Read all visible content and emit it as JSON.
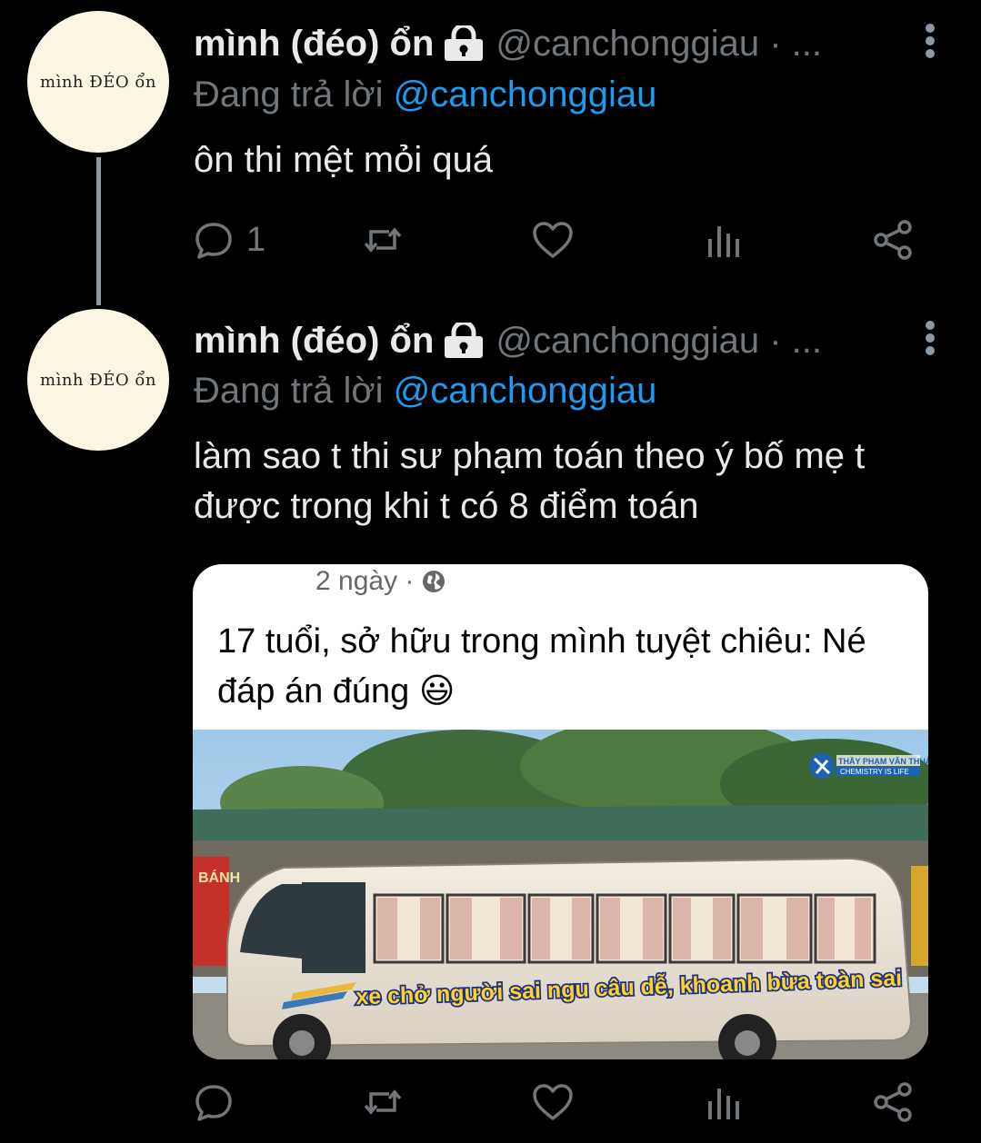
{
  "tweets": [
    {
      "avatar_text": "mình ĐÉO ổn",
      "display_name": "mình (đéo) ổn",
      "handle": "@canchonggiau · ...",
      "reply_prefix": "Đang trả lời",
      "reply_to": "@canchonggiau",
      "text": "ôn thi mệt mỏi quá",
      "reply_count": "1"
    },
    {
      "avatar_text": "mình ĐÉO ổn",
      "display_name": "mình (đéo) ổn",
      "handle": "@canchonggiau · ...",
      "reply_prefix": "Đang trả lời",
      "reply_to": "@canchonggiau",
      "text": "làm sao t thi sư phạm toán theo ý bố mẹ t được trong khi t có 8 điểm toán",
      "reply_count": ""
    }
  ],
  "media": {
    "time": "2 ngày ·",
    "post_text": "17 tuổi, sở hữu trong mình tuyệt chiêu: Né đáp án đúng 😃",
    "bus_caption": "xe chở người sai ngu câu dễ, khoanh bừa toàn sai",
    "watermark_line1": "THẦY PHẠM VĂN THUẬN",
    "watermark_line2": "CHEMISTRY IS LIFE",
    "shop_sign": "BÁNH"
  },
  "colors": {
    "background": "#000000",
    "primary_text": "#e7e9ea",
    "secondary_text": "#71767b",
    "link": "#1d9bf0",
    "avatar_bg": "#fbf6e4"
  }
}
